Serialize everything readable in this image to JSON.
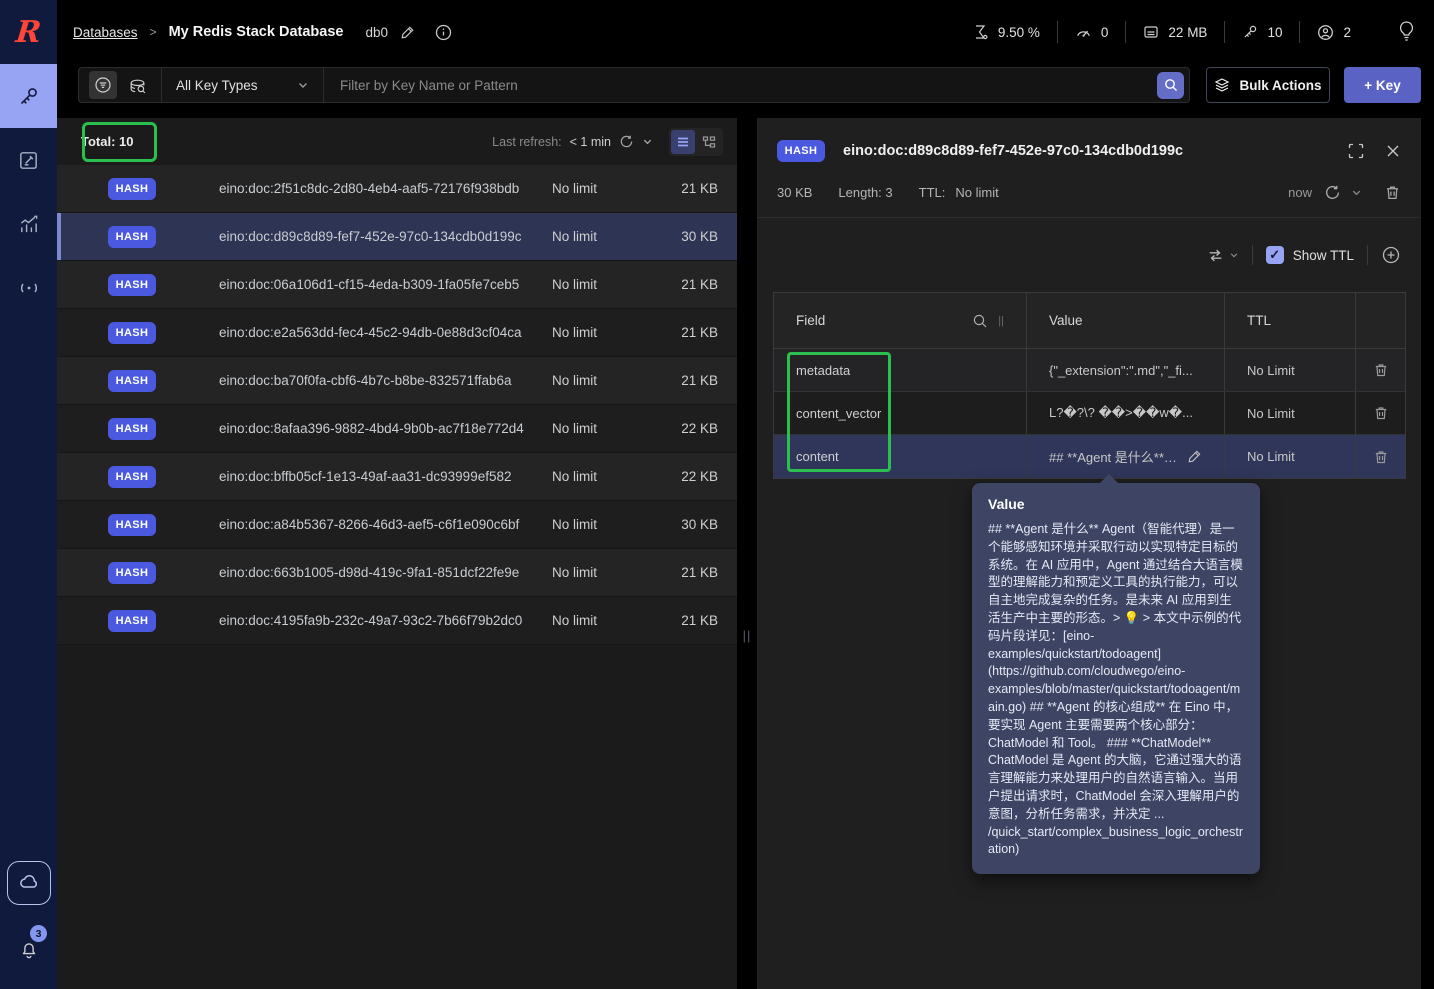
{
  "topbar": {
    "breadcrumb": {
      "root": "Databases",
      "separator": ">",
      "current": "My Redis Stack Database"
    },
    "db_index": "db0",
    "stats": [
      {
        "icon": "cpu-icon",
        "value": "9.50 %"
      },
      {
        "icon": "commands-per-sec-icon",
        "value": "0"
      },
      {
        "icon": "memory-icon",
        "value": "22 MB"
      },
      {
        "icon": "total-keys-icon",
        "value": "10"
      },
      {
        "icon": "connected-clients-icon",
        "value": "2"
      }
    ]
  },
  "sidebar": {
    "items": [
      "browser",
      "workbench",
      "analytics",
      "pub-sub"
    ],
    "notification_count": "3"
  },
  "filter": {
    "key_type_selector": "All Key Types",
    "search_placeholder": "Filter by Key Name or Pattern",
    "bulk_actions_label": "Bulk Actions",
    "add_key_label": "+ Key"
  },
  "key_list": {
    "total_label": "Total: 10",
    "last_refresh_label": "Last refresh:",
    "last_refresh_value": "< 1 min",
    "rows": [
      {
        "type": "HASH",
        "name": "eino:doc:2f51c8dc-2d80-4eb4-aaf5-72176f938bdb",
        "ttl": "No limit",
        "size": "21 KB"
      },
      {
        "type": "HASH",
        "name": "eino:doc:d89c8d89-fef7-452e-97c0-134cdb0d199c",
        "ttl": "No limit",
        "size": "30 KB",
        "selected": true
      },
      {
        "type": "HASH",
        "name": "eino:doc:06a106d1-cf15-4eda-b309-1fa05fe7ceb5",
        "ttl": "No limit",
        "size": "21 KB"
      },
      {
        "type": "HASH",
        "name": "eino:doc:e2a563dd-fec4-45c2-94db-0e88d3cf04ca",
        "ttl": "No limit",
        "size": "21 KB"
      },
      {
        "type": "HASH",
        "name": "eino:doc:ba70f0fa-cbf6-4b7c-b8be-832571ffab6a",
        "ttl": "No limit",
        "size": "21 KB"
      },
      {
        "type": "HASH",
        "name": "eino:doc:8afaa396-9882-4bd4-9b0b-ac7f18e772d4",
        "ttl": "No limit",
        "size": "22 KB"
      },
      {
        "type": "HASH",
        "name": "eino:doc:bffb05cf-1e13-49af-aa31-dc93999ef582",
        "ttl": "No limit",
        "size": "22 KB"
      },
      {
        "type": "HASH",
        "name": "eino:doc:a84b5367-8266-46d3-aef5-c6f1e090c6bf",
        "ttl": "No limit",
        "size": "30 KB"
      },
      {
        "type": "HASH",
        "name": "eino:doc:663b1005-d98d-419c-9fa1-851dcf22fe9e",
        "ttl": "No limit",
        "size": "21 KB"
      },
      {
        "type": "HASH",
        "name": "eino:doc:4195fa9b-232c-49a7-93c2-7b66f79b2dc0",
        "ttl": "No limit",
        "size": "21 KB"
      }
    ]
  },
  "key_detail": {
    "type_badge": "HASH",
    "name": "eino:doc:d89c8d89-fef7-452e-97c0-134cdb0d199c",
    "size": "30 KB",
    "length_label": "Length: 3",
    "ttl_label": "TTL:",
    "ttl_value": "No limit",
    "refreshed": "now",
    "show_ttl_label": "Show TTL",
    "show_ttl_checked": true,
    "table": {
      "headers": [
        "Field",
        "Value",
        "TTL"
      ],
      "rows": [
        {
          "field": "metadata",
          "value": "{\"_extension\":\".md\",\"_fi...",
          "ttl": "No Limit"
        },
        {
          "field": "content_vector",
          "value": "L?�?\\? ��>��w�...",
          "ttl": "No Limit"
        },
        {
          "field": "content",
          "value": "## **Agent 是什么** A...",
          "ttl": "No Limit",
          "selected": true,
          "editable": true
        }
      ]
    }
  },
  "tooltip": {
    "title": "Value",
    "body": "## **Agent 是什么** Agent（智能代理）是一个能够感知环境并采取行动以实现特定目标的系统。在 AI 应用中，Agent 通过结合大语言模型的理解能力和预定义工具的执行能力，可以自主地完成复杂的任务。是未来 AI 应用到生活生产中主要的形态。> 💡 > 本文中示例的代码片段详见：[eino-examples/quickstart/todoagent](https://github.com/cloudwego/eino-examples/blob/master/quickstart/todoagent/main.go) ## **Agent 的核心组成** 在 Eino 中，要实现 Agent 主要需要两个核心部分：ChatModel 和 Tool。 ### **ChatModel** ChatModel 是 Agent 的大脑，它通过强大的语言理解能力来处理用户的自然语言输入。当用户提出请求时，ChatModel 会深入理解用户的意图，分析任务需求，并决定 ... /quick_start/complex_business_logic_orchestration)"
  },
  "colors": {
    "brand_red": "#ff4438",
    "hash_badge": "#4b59e0",
    "accent_periwinkle": "#97a3f3",
    "primary_button": "#5a63c4",
    "annotation_green": "#2abf4f",
    "selected_row": "#2e3454",
    "tooltip_bg": "#3d4464"
  }
}
